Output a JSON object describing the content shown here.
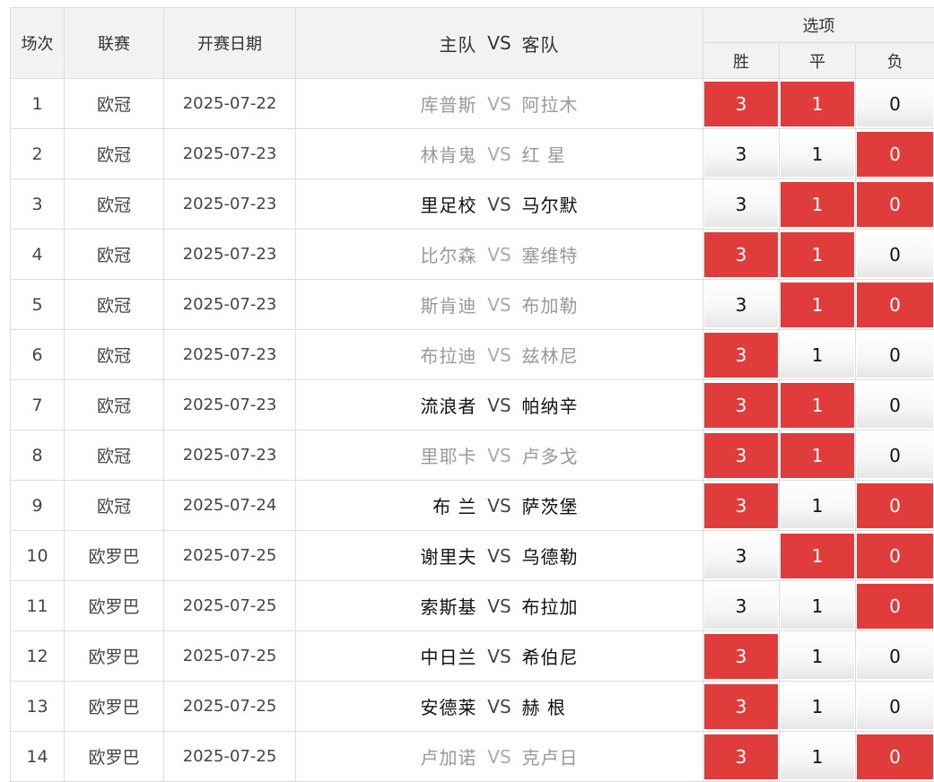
{
  "header": {
    "col_no": "场次",
    "col_league": "联赛",
    "col_date": "开赛日期",
    "col_home": "主队",
    "col_vs": "VS",
    "col_away": "客队",
    "col_options": "选项",
    "opt_win": "胜",
    "opt_draw": "平",
    "opt_lose": "负"
  },
  "colors": {
    "selected": "#e03c3c",
    "header_bg": "#f2f2f2"
  },
  "rows": [
    {
      "no": "1",
      "league": "欧冠",
      "date": "2025-07-22",
      "home": "库普斯",
      "vs": "VS",
      "away": "阿拉木",
      "tone": "gray",
      "win": "3",
      "draw": "1",
      "lose": "0",
      "sel_win": true,
      "sel_draw": true,
      "sel_lose": false
    },
    {
      "no": "2",
      "league": "欧冠",
      "date": "2025-07-23",
      "home": "林肯鬼",
      "vs": "VS",
      "away": "红 星",
      "tone": "gray",
      "win": "3",
      "draw": "1",
      "lose": "0",
      "sel_win": false,
      "sel_draw": false,
      "sel_lose": true
    },
    {
      "no": "3",
      "league": "欧冠",
      "date": "2025-07-23",
      "home": "里足校",
      "vs": "VS",
      "away": "马尔默",
      "tone": "dark",
      "win": "3",
      "draw": "1",
      "lose": "0",
      "sel_win": false,
      "sel_draw": true,
      "sel_lose": true
    },
    {
      "no": "4",
      "league": "欧冠",
      "date": "2025-07-23",
      "home": "比尔森",
      "vs": "VS",
      "away": "塞维特",
      "tone": "gray",
      "win": "3",
      "draw": "1",
      "lose": "0",
      "sel_win": true,
      "sel_draw": true,
      "sel_lose": false
    },
    {
      "no": "5",
      "league": "欧冠",
      "date": "2025-07-23",
      "home": "斯肯迪",
      "vs": "VS",
      "away": "布加勒",
      "tone": "gray",
      "win": "3",
      "draw": "1",
      "lose": "0",
      "sel_win": false,
      "sel_draw": true,
      "sel_lose": true
    },
    {
      "no": "6",
      "league": "欧冠",
      "date": "2025-07-23",
      "home": "布拉迪",
      "vs": "VS",
      "away": "兹林尼",
      "tone": "gray",
      "win": "3",
      "draw": "1",
      "lose": "0",
      "sel_win": true,
      "sel_draw": false,
      "sel_lose": false
    },
    {
      "no": "7",
      "league": "欧冠",
      "date": "2025-07-23",
      "home": "流浪者",
      "vs": "VS",
      "away": "帕纳辛",
      "tone": "dark",
      "win": "3",
      "draw": "1",
      "lose": "0",
      "sel_win": true,
      "sel_draw": true,
      "sel_lose": false
    },
    {
      "no": "8",
      "league": "欧冠",
      "date": "2025-07-23",
      "home": "里耶卡",
      "vs": "VS",
      "away": "卢多戈",
      "tone": "gray",
      "win": "3",
      "draw": "1",
      "lose": "0",
      "sel_win": true,
      "sel_draw": true,
      "sel_lose": false
    },
    {
      "no": "9",
      "league": "欧冠",
      "date": "2025-07-24",
      "home": "布 兰",
      "vs": "VS",
      "away": "萨茨堡",
      "tone": "dark",
      "win": "3",
      "draw": "1",
      "lose": "0",
      "sel_win": true,
      "sel_draw": false,
      "sel_lose": true
    },
    {
      "no": "10",
      "league": "欧罗巴",
      "date": "2025-07-25",
      "home": "谢里夫",
      "vs": "VS",
      "away": "乌德勒",
      "tone": "dark",
      "win": "3",
      "draw": "1",
      "lose": "0",
      "sel_win": false,
      "sel_draw": true,
      "sel_lose": true
    },
    {
      "no": "11",
      "league": "欧罗巴",
      "date": "2025-07-25",
      "home": "索斯基",
      "vs": "VS",
      "away": "布拉加",
      "tone": "dark",
      "win": "3",
      "draw": "1",
      "lose": "0",
      "sel_win": false,
      "sel_draw": false,
      "sel_lose": true
    },
    {
      "no": "12",
      "league": "欧罗巴",
      "date": "2025-07-25",
      "home": "中日兰",
      "vs": "VS",
      "away": "希伯尼",
      "tone": "dark",
      "win": "3",
      "draw": "1",
      "lose": "0",
      "sel_win": true,
      "sel_draw": false,
      "sel_lose": false
    },
    {
      "no": "13",
      "league": "欧罗巴",
      "date": "2025-07-25",
      "home": "安德莱",
      "vs": "VS",
      "away": "赫 根",
      "tone": "dark",
      "win": "3",
      "draw": "1",
      "lose": "0",
      "sel_win": true,
      "sel_draw": false,
      "sel_lose": false
    },
    {
      "no": "14",
      "league": "欧罗巴",
      "date": "2025-07-25",
      "home": "卢加诺",
      "vs": "VS",
      "away": "克卢日",
      "tone": "gray",
      "win": "3",
      "draw": "1",
      "lose": "0",
      "sel_win": true,
      "sel_draw": false,
      "sel_lose": true
    }
  ]
}
